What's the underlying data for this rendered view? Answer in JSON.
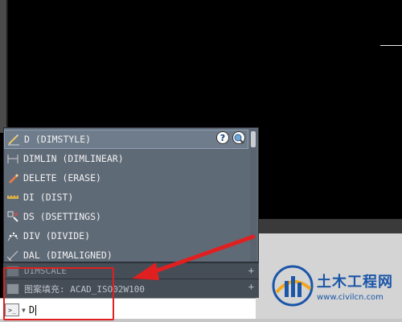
{
  "autocomplete": {
    "items": [
      {
        "label": "D (DIMSTYLE)",
        "icon": "dimstyle-icon",
        "selected": true
      },
      {
        "label": "DIMLIN (DIMLINEAR)",
        "icon": "dimlinear-icon"
      },
      {
        "label": "DELETE (ERASE)",
        "icon": "erase-icon"
      },
      {
        "label": "DI (DIST)",
        "icon": "distance-ruler-icon"
      },
      {
        "label": "DS (DSETTINGS)",
        "icon": "dsettings-icon"
      },
      {
        "label": "DIV (DIVIDE)",
        "icon": "divide-icon"
      },
      {
        "label": "DAL (DIMALIGNED)",
        "icon": "dimaligned-icon"
      }
    ],
    "help_label": "?"
  },
  "history": {
    "row1": "DIMSCALE",
    "row2": "图案填充: ACAD_ISO02W100"
  },
  "command_line": {
    "value": "D"
  },
  "watermark": {
    "title": "土木工程网",
    "url": "www.civilcn.com"
  },
  "colors": {
    "annotation_red": "#e02020",
    "dropdown_bg": "#5f6a77",
    "canvas_bg": "#000000"
  }
}
